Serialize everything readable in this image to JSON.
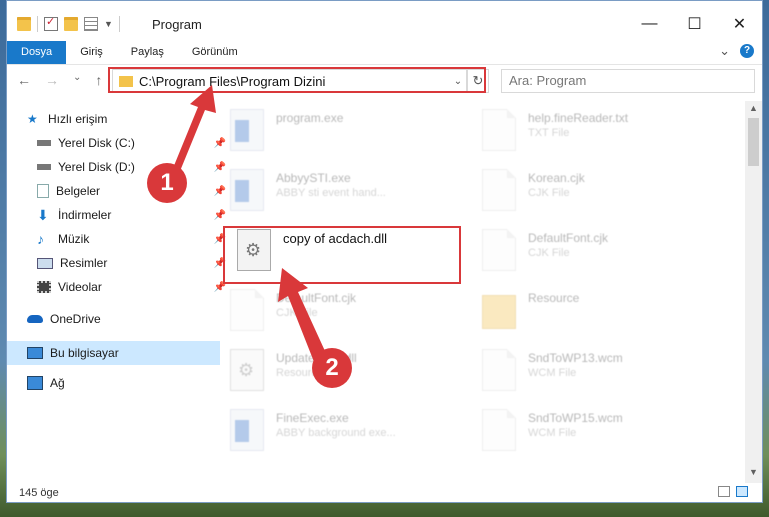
{
  "window": {
    "title": "Program",
    "minimize": "—",
    "maximize": "☐",
    "close": "✕"
  },
  "ribbon": {
    "tabs": [
      "Dosya",
      "Giriş",
      "Paylaş",
      "Görünüm"
    ],
    "expand": "⌄",
    "help": "?"
  },
  "nav": {
    "back": "←",
    "forward": "→",
    "dropdown": "⌄",
    "up": "↑"
  },
  "address": {
    "path": "C:\\Program Files\\Program Dizini",
    "dropdown": "⌄",
    "refresh": "↻"
  },
  "search": {
    "placeholder": "Ara: Program"
  },
  "sidebar": {
    "items": [
      {
        "label": "Hızlı erişim",
        "icon": "star-icon",
        "pinned": false
      },
      {
        "label": "Yerel Disk (C:)",
        "icon": "drive-icon",
        "pinned": true
      },
      {
        "label": "Yerel Disk (D:)",
        "icon": "drive-icon",
        "pinned": true
      },
      {
        "label": "Belgeler",
        "icon": "documents-icon",
        "pinned": true
      },
      {
        "label": "İndirmeler",
        "icon": "download-icon",
        "pinned": true
      },
      {
        "label": "Müzik",
        "icon": "music-icon",
        "pinned": true
      },
      {
        "label": "Resimler",
        "icon": "pictures-icon",
        "pinned": true
      },
      {
        "label": "Videolar",
        "icon": "videos-icon",
        "pinned": true
      },
      {
        "label": "OneDrive",
        "icon": "cloud-icon",
        "pinned": false
      },
      {
        "label": "Bu bilgisayar",
        "icon": "computer-icon",
        "pinned": false
      },
      {
        "label": "Ağ",
        "icon": "network-icon",
        "pinned": false
      }
    ]
  },
  "files": {
    "left": [
      {
        "name": "program.exe",
        "desc": "",
        "type": "exe"
      },
      {
        "name": "AbbyySTI.exe",
        "desc": "ABBY sti event hand...",
        "type": "exe"
      },
      {
        "name": "copy of acdach.dll",
        "desc": "",
        "type": "gear"
      },
      {
        "name": "DefaultFont.cjk",
        "desc": "CJK File",
        "type": "doc"
      },
      {
        "name": "Updater...65.dll",
        "desc": "Resource...",
        "type": "gear"
      },
      {
        "name": "FineExec.exe",
        "desc": "ABBY background exe...",
        "type": "exe"
      }
    ],
    "right": [
      {
        "name": "help.fineReader.txt",
        "desc": "TXT File",
        "type": "doc"
      },
      {
        "name": "Korean.cjk",
        "desc": "CJK File",
        "type": "doc"
      },
      {
        "name": "DefaultFont.cjk",
        "desc": "CJK File",
        "type": "doc"
      },
      {
        "name": "Resource",
        "desc": "",
        "type": "folder"
      },
      {
        "name": "SndToWP13.wcm",
        "desc": "WCM File",
        "type": "doc"
      },
      {
        "name": "SndToWP15.wcm",
        "desc": "WCM File",
        "type": "doc"
      }
    ]
  },
  "annotations": {
    "step1": "1",
    "step2": "2",
    "accent": "#d9383a"
  },
  "status": {
    "count": "145 öge"
  }
}
